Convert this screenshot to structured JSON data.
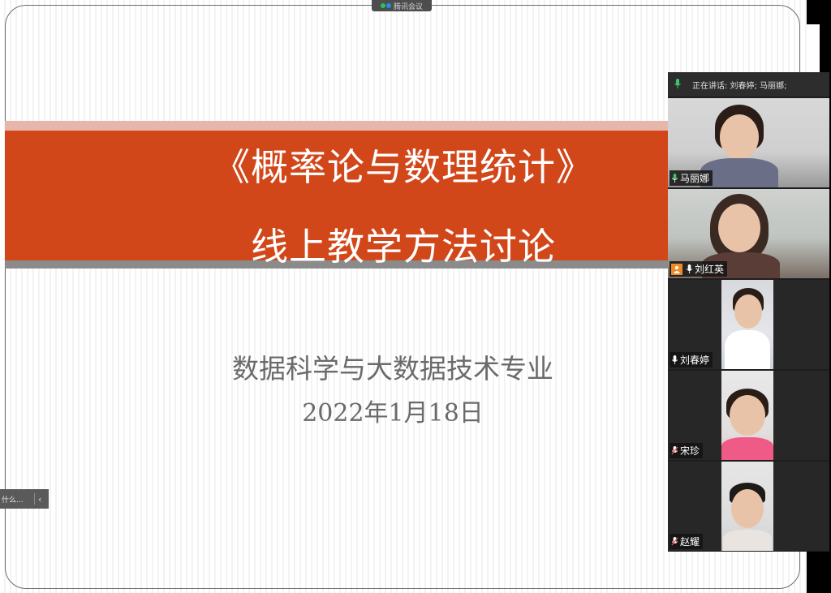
{
  "app": {
    "badge_label": "腾讯会议"
  },
  "slide": {
    "title_line1": "《概率论与数理统计》",
    "title_line2": "线上教学方法讨论",
    "subtitle_line1": "数据科学与大数据技术专业",
    "subtitle_line2": "2022年1月18日"
  },
  "toast": {
    "text": "什么..."
  },
  "speaking": {
    "label": "正在讲话: 刘春婷; 马丽娜;"
  },
  "participants": [
    {
      "name": "马丽娜",
      "mic": "on"
    },
    {
      "name": "刘红英",
      "mic": "on",
      "host": true
    },
    {
      "name": "刘春婷",
      "mic": "on"
    },
    {
      "name": "宋珍",
      "mic": "off"
    },
    {
      "name": "赵耀",
      "mic": "off"
    }
  ],
  "colors": {
    "banner": "#d1471a",
    "stripe_pink": "#e7b6aa",
    "stripe_gray": "#8b8b8b",
    "mic_on": "#3ac46b",
    "host_badge": "#f08a24"
  }
}
